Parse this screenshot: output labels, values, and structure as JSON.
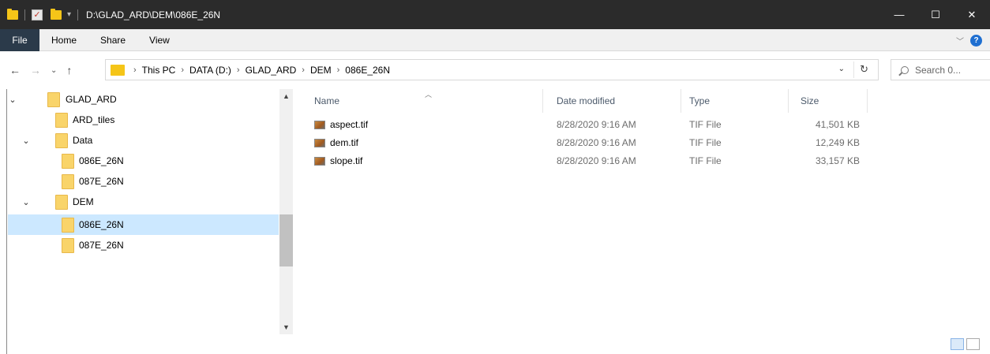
{
  "window": {
    "title": "D:\\GLAD_ARD\\DEM\\086E_26N",
    "minimize": "—",
    "maximize": "☐",
    "close": "✕"
  },
  "ribbon": {
    "tabs": [
      "File",
      "Home",
      "Share",
      "View"
    ],
    "help": "?"
  },
  "address": {
    "crumbs": [
      "This PC",
      "DATA (D:)",
      "GLAD_ARD",
      "DEM",
      "086E_26N"
    ],
    "search_placeholder": "Search 0..."
  },
  "tree": [
    {
      "label": "GLAD_ARD",
      "level": 0,
      "expanded": true
    },
    {
      "label": "ARD_tiles",
      "level": 1
    },
    {
      "label": "Data",
      "level": 1,
      "expanded": true
    },
    {
      "label": "086E_26N",
      "level": 2
    },
    {
      "label": "087E_26N",
      "level": 2
    },
    {
      "label": "DEM",
      "level": 1,
      "expanded": true
    },
    {
      "label": "086E_26N",
      "level": 2,
      "selected": true
    },
    {
      "label": "087E_26N",
      "level": 2
    }
  ],
  "columns": {
    "name": "Name",
    "date": "Date modified",
    "type": "Type",
    "size": "Size"
  },
  "files": [
    {
      "name": "aspect.tif",
      "date": "8/28/2020 9:16 AM",
      "type": "TIF File",
      "size": "41,501 KB"
    },
    {
      "name": "dem.tif",
      "date": "8/28/2020 9:16 AM",
      "type": "TIF File",
      "size": "12,249 KB"
    },
    {
      "name": "slope.tif",
      "date": "8/28/2020 9:16 AM",
      "type": "TIF File",
      "size": "33,157 KB"
    }
  ],
  "icons": {
    "folder": "folder-icon",
    "tif": "tif-file-icon",
    "back": "back-arrow-icon",
    "forward": "forward-arrow-icon",
    "up": "up-arrow-icon",
    "refresh": "refresh-icon",
    "search": "search-icon"
  }
}
